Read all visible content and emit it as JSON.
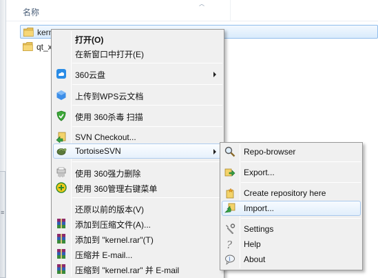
{
  "explorer": {
    "column_name": "名称",
    "files": [
      "kernel",
      "qt_x"
    ]
  },
  "main_menu": {
    "items": [
      {
        "label": "打开(O)",
        "bold": true,
        "icon": "none"
      },
      {
        "label": "在新窗口中打开(E)",
        "icon": "none"
      },
      {
        "label": "360云盘",
        "icon": "cloud-icon",
        "submenu": true
      },
      {
        "label": "上传到WPS云文档",
        "icon": "wps-cloud-icon"
      },
      {
        "label": "使用 360杀毒 扫描",
        "icon": "shield-icon"
      },
      {
        "label": "SVN Checkout...",
        "icon": "svn-checkout-icon"
      },
      {
        "label": "TortoiseSVN",
        "icon": "tortoise-icon",
        "submenu": true
      },
      {
        "label": "使用 360强力删除",
        "icon": "shredder-icon"
      },
      {
        "label": "使用 360管理右键菜单",
        "icon": "plus-circle-icon"
      },
      {
        "label": "还原以前的版本(V)",
        "icon": "none"
      },
      {
        "label": "添加到压缩文件(A)...",
        "icon": "winrar-icon"
      },
      {
        "label": "添加到 \"kernel.rar\"(T)",
        "icon": "winrar-icon"
      },
      {
        "label": "压缩并 E-mail...",
        "icon": "winrar-icon"
      },
      {
        "label": "压缩到 \"kernel.rar\" 并 E-mail",
        "icon": "winrar-icon"
      }
    ]
  },
  "sub_menu": {
    "items": [
      {
        "label": "Repo-browser",
        "icon": "repo-browser-icon"
      },
      {
        "label": "Export...",
        "icon": "export-icon"
      },
      {
        "label": "Create repository here",
        "icon": "create-repo-icon"
      },
      {
        "label": "Import...",
        "icon": "import-icon"
      },
      {
        "label": "Settings",
        "icon": "settings-icon"
      },
      {
        "label": "Help",
        "icon": "help-icon"
      },
      {
        "label": "About",
        "icon": "about-icon"
      }
    ]
  }
}
